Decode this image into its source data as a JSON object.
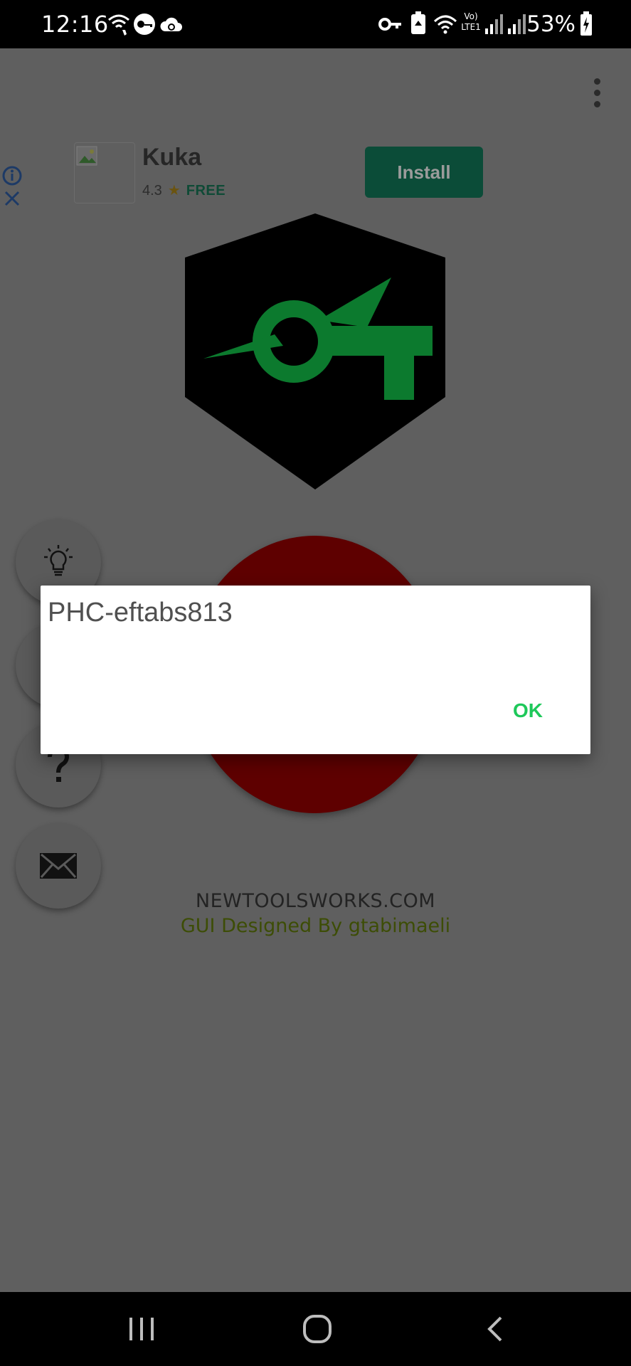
{
  "status_bar": {
    "time": "12:16",
    "battery_percent": "53%",
    "network_label": "Vo) LTE1",
    "icons": [
      "wifi-call-icon",
      "vpn-icon",
      "cloud-sync-icon",
      "key-icon",
      "recycle-icon",
      "wifi-icon",
      "signal-icon",
      "signal-icon",
      "battery-charging-icon"
    ]
  },
  "ad": {
    "app_name": "Kuka",
    "rating": "4.3",
    "price": "FREE",
    "install_label": "Install",
    "icons": [
      "info-icon",
      "close-icon",
      "star-icon"
    ]
  },
  "side_actions": [
    "lightbulb-icon",
    "question-icon",
    "mail-icon"
  ],
  "footer": {
    "site": "NEWTOOLSWORKS.COM",
    "credit": "GUI  Designed By gtabimaeli"
  },
  "dialog": {
    "message": "PHC-eftabs813",
    "ok_label": "OK"
  },
  "colors": {
    "logo_green": "#0c7a2e",
    "logo_black": "#000000",
    "power_red": "#5e0000",
    "ok_green": "#1ec85a",
    "install_green": "#0b4c38"
  }
}
